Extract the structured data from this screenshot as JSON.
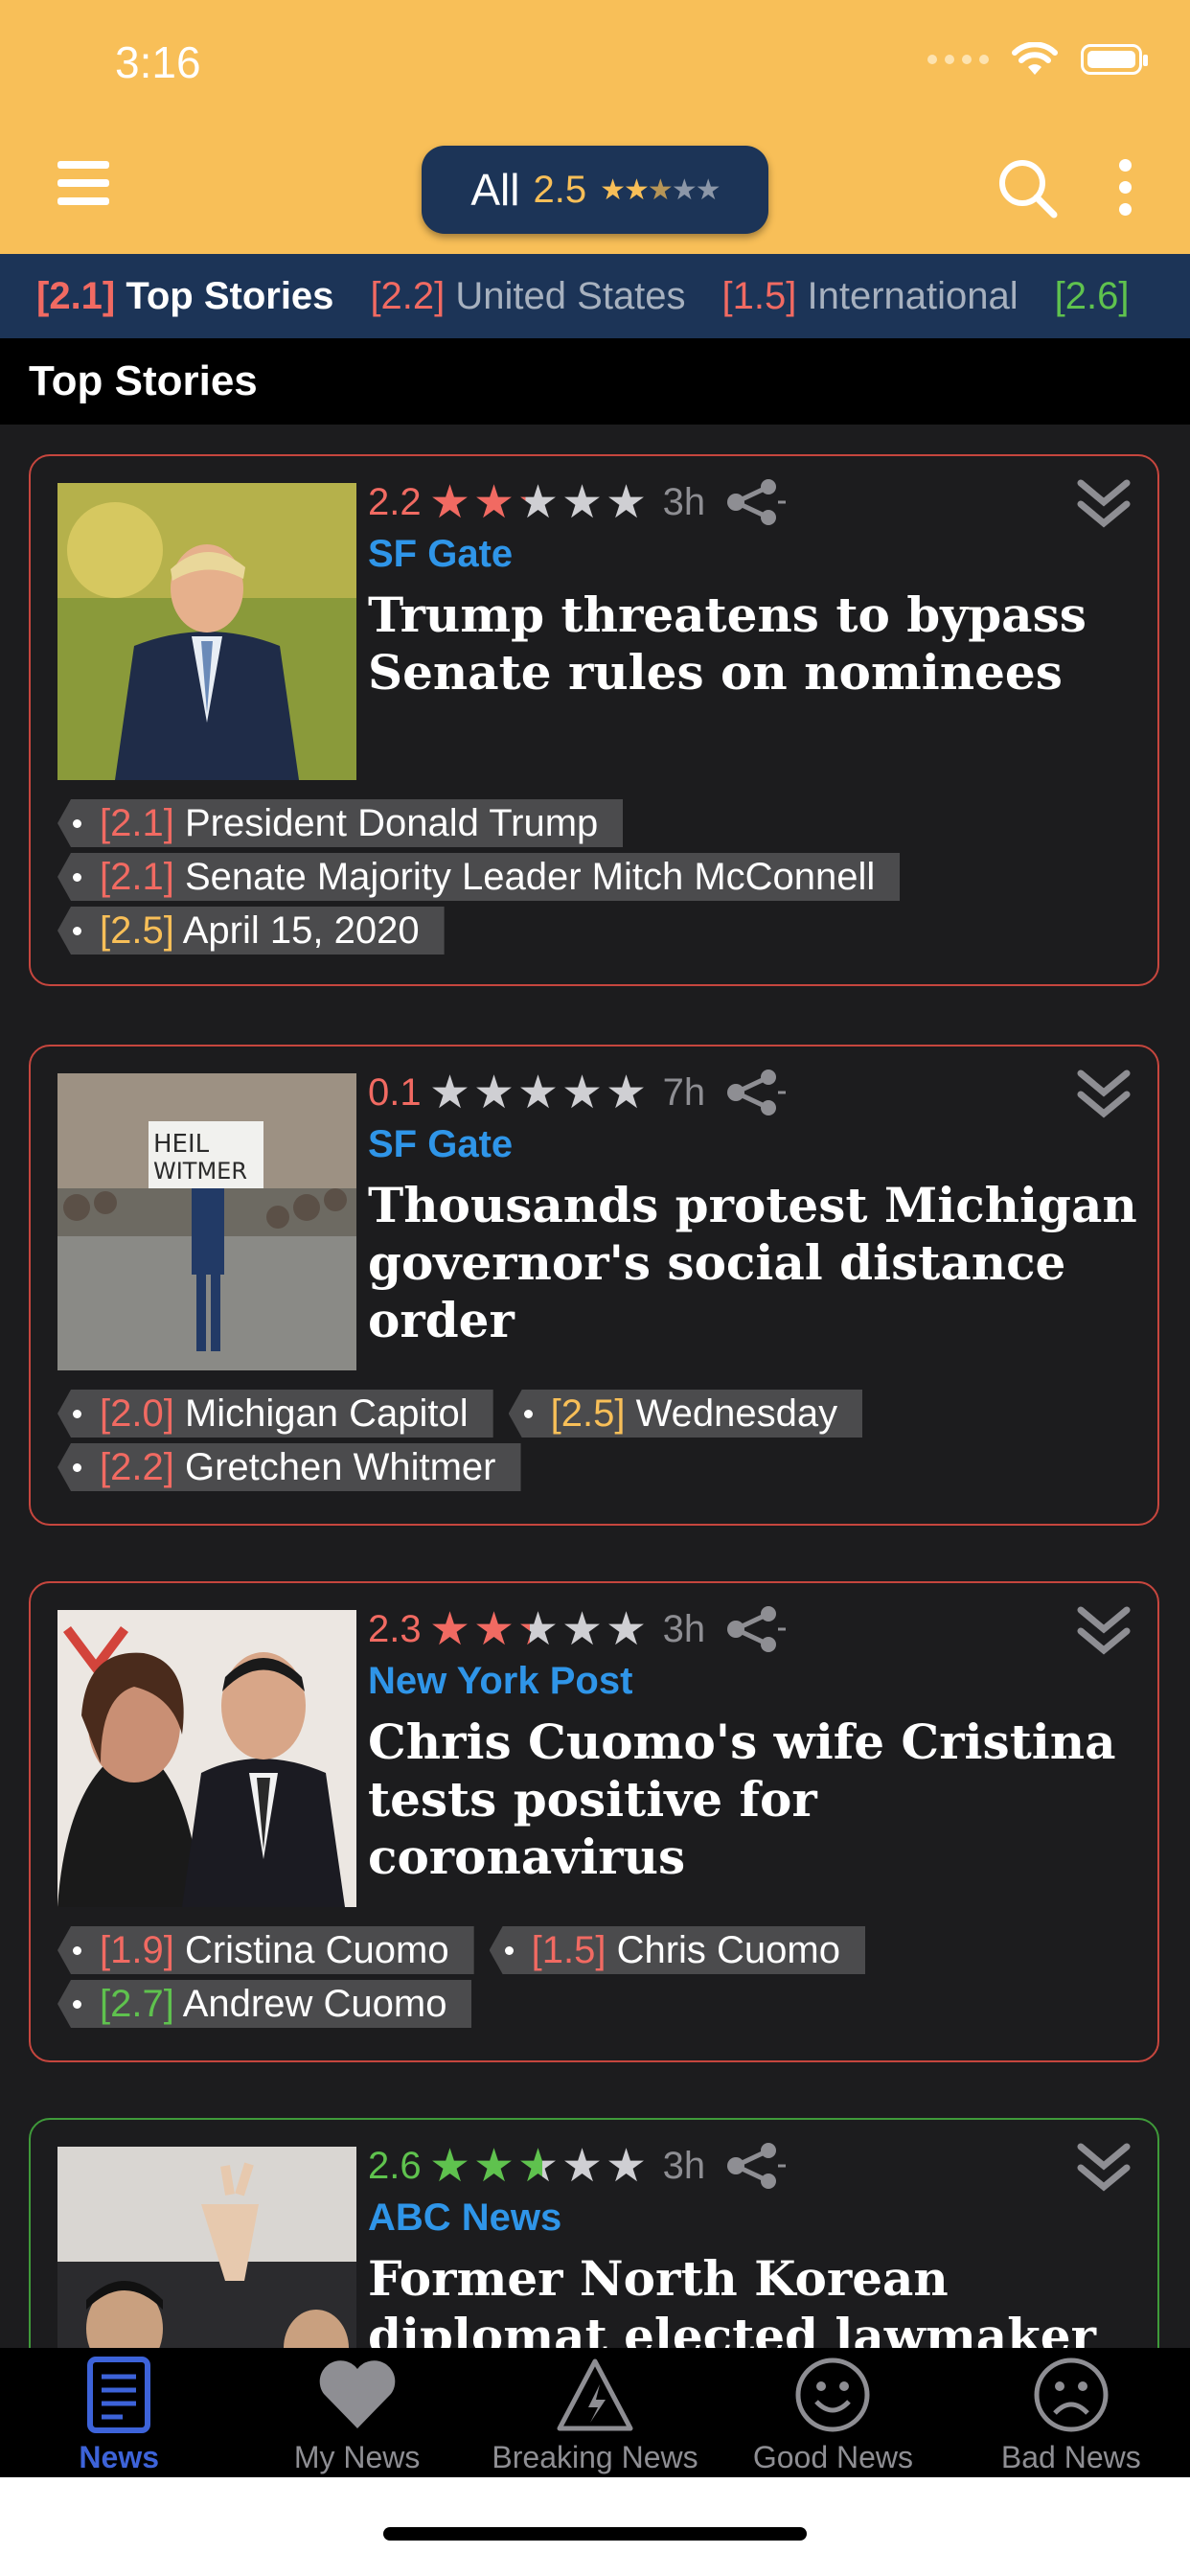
{
  "status_bar": {
    "time": "3:16"
  },
  "nav": {
    "all_label": "All",
    "all_score": "2.5",
    "all_stars": 2.5
  },
  "categories": [
    {
      "score": "[2.1]",
      "name": "Top Stories"
    },
    {
      "score": "[2.2]",
      "name": "United States"
    },
    {
      "score": "[1.5]",
      "name": "International"
    },
    {
      "score": "[2.6]",
      "name": ""
    }
  ],
  "section_title": "Top Stories",
  "articles": [
    {
      "rating": "2.2",
      "rating_value": 2.2,
      "age": "3h",
      "source": "SF Gate",
      "headline": "Trump threatens to bypass Senate rules on nominees",
      "tags": [
        {
          "score": "[2.1]",
          "label": "President Donald Trump",
          "color": "red"
        },
        {
          "score": "[2.1]",
          "label": "Senate Majority Leader Mitch McConnell",
          "color": "red"
        },
        {
          "score": "[2.5]",
          "label": "April 15, 2020",
          "color": "orange"
        }
      ]
    },
    {
      "rating": "0.1",
      "rating_value": 0.1,
      "age": "7h",
      "source": "SF Gate",
      "headline": "Thousands protest Michigan governor's social distance order",
      "tags": [
        {
          "score": "[2.0]",
          "label": "Michigan Capitol",
          "color": "red"
        },
        {
          "score": "[2.5]",
          "label": "Wednesday",
          "color": "orange"
        },
        {
          "score": "[2.2]",
          "label": "Gretchen Whitmer",
          "color": "red"
        }
      ]
    },
    {
      "rating": "2.3",
      "rating_value": 2.3,
      "age": "3h",
      "source": "New York Post",
      "headline": "Chris Cuomo's wife Cristina tests positive for coronavirus",
      "tags": [
        {
          "score": "[1.9]",
          "label": "Cristina Cuomo",
          "color": "red"
        },
        {
          "score": "[1.5]",
          "label": "Chris Cuomo",
          "color": "red"
        },
        {
          "score": "[2.7]",
          "label": "Andrew Cuomo",
          "color": "green"
        }
      ]
    },
    {
      "rating": "2.6",
      "rating_value": 2.6,
      "age": "3h",
      "source": "ABC News",
      "headline": "Former North Korean diplomat elected lawmaker in South",
      "tags": []
    }
  ],
  "tab_bar": [
    {
      "label": "News",
      "icon": "news-icon"
    },
    {
      "label": "My News",
      "icon": "heart-icon"
    },
    {
      "label": "Breaking News",
      "icon": "warning-icon"
    },
    {
      "label": "Good News",
      "icon": "smile-icon"
    },
    {
      "label": "Bad News",
      "icon": "frown-icon"
    }
  ],
  "colors": {
    "header": "#f8bf58",
    "navy": "#1c3457",
    "red": "#f16a62",
    "green": "#5fc24e",
    "blue": "#2f95e8",
    "active_tab": "#3d63d9"
  }
}
